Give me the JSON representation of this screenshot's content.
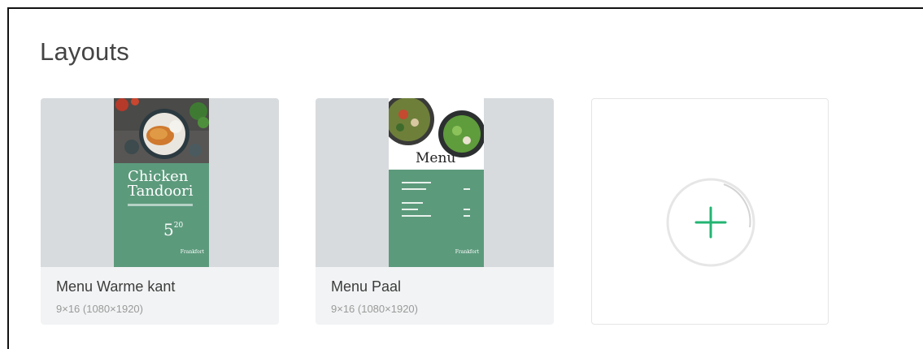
{
  "section": {
    "title": "Layouts"
  },
  "layouts": [
    {
      "name": "Menu Warme kant",
      "meta": "9×16 (1080×1920)",
      "poster": {
        "headline_line1": "Chicken",
        "headline_line2": "Tandoori",
        "price_main": "5",
        "price_cents": "20",
        "brand": "Frankfort"
      }
    },
    {
      "name": "Menu Paal",
      "meta": "9×16 (1080×1920)",
      "poster": {
        "headline": "Menu",
        "brand": "Frankfort"
      }
    }
  ],
  "add_layout": {
    "icon": "plus-icon"
  },
  "colors": {
    "accent": "#22b573",
    "poster_green": "#5c9a7c",
    "thumb_bg": "#d8dbde",
    "card_bg": "#f2f3f4"
  }
}
